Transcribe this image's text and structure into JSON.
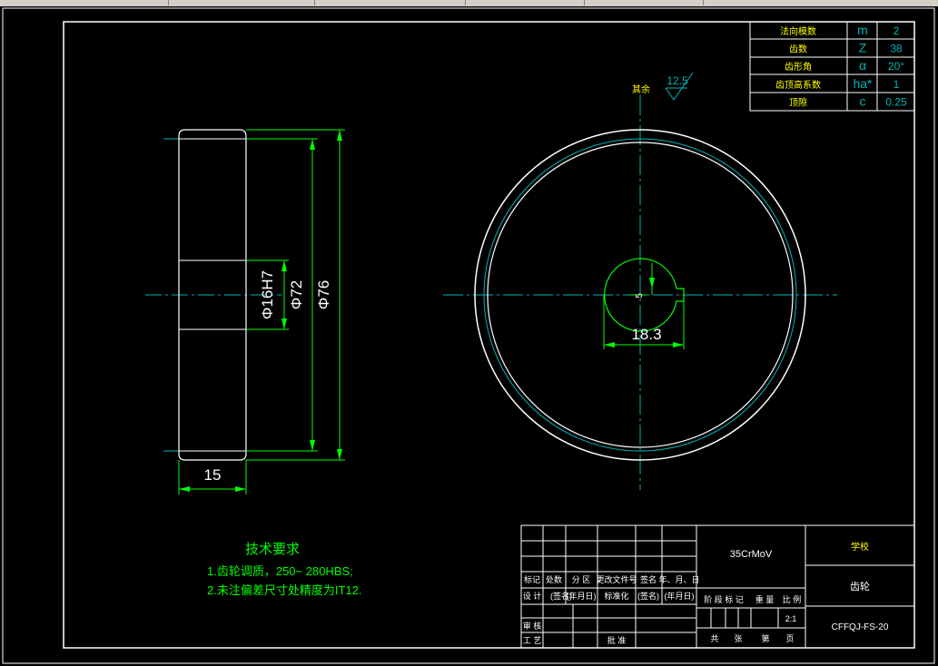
{
  "params": [
    {
      "name": "法向模数",
      "sym": "m",
      "val": "2"
    },
    {
      "name": "齿数",
      "sym": "Z",
      "val": "38"
    },
    {
      "name": "齿形角",
      "sym": "α",
      "val": "20°"
    },
    {
      "name": "齿顶高系数",
      "sym": "ha*",
      "val": "1"
    },
    {
      "name": "顶隙",
      "sym": "c",
      "val": "0.25"
    }
  ],
  "roughness": {
    "value": "12.5",
    "label": "其余"
  },
  "dims": {
    "bore": "Φ16H7",
    "d72": "Φ72",
    "d76": "Φ76",
    "width": "15",
    "keyway": "18.3",
    "key_small": "5"
  },
  "tech": {
    "title": "技术要求",
    "line1": "1.齿轮调质，250~ 280HBS;",
    "line2": "2.未注偏差尺寸处精度为IT12."
  },
  "titleblock": {
    "material": "35CrMoV",
    "school": "学校",
    "part_name": "齿轮",
    "drawing_no": "CFFQJ-FS-20",
    "scale": "2:1",
    "h1": "标记",
    "h2": "处数",
    "h3": "分 区",
    "h4": "更改文件号",
    "h5": "签名",
    "h6": "年、月、日",
    "r1": "设 计",
    "r2": "(签名)",
    "r3": "(年月日)",
    "r4": "标准化",
    "r5": "(签名)",
    "r6": "(年月日)",
    "stage": "阶 段 标 记",
    "weight": "重 量",
    "ratio": "比 例",
    "review": "审 核",
    "process": "工 艺",
    "approve": "批 准",
    "total": "共",
    "sheet": "张",
    "page": "第",
    "pagesuffix": "页"
  }
}
